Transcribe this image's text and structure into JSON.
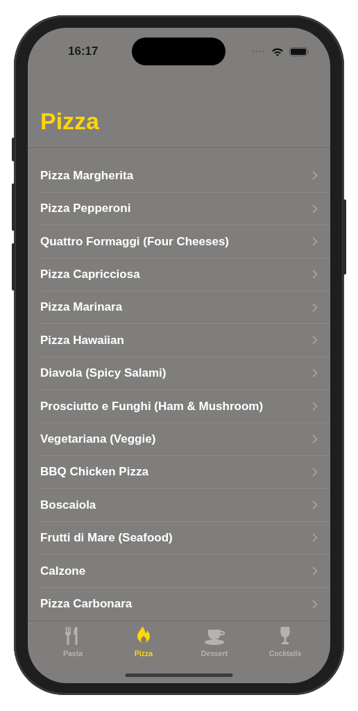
{
  "status_bar": {
    "time": "16:17"
  },
  "title": "Pizza",
  "items": [
    "Pizza Margherita",
    "Pizza Pepperoni",
    "Quattro Formaggi (Four Cheeses)",
    "Pizza Capricciosa",
    "Pizza Marinara",
    "Pizza Hawaiian",
    "Diavola (Spicy Salami)",
    "Prosciutto e Funghi (Ham & Mushroom)",
    "Vegetariana (Veggie)",
    "BBQ Chicken Pizza",
    "Boscaiola",
    "Frutti di Mare (Seafood)",
    "Calzone",
    "Pizza Carbonara"
  ],
  "tabs": [
    {
      "label": "Pasta",
      "kind": "fork-knife",
      "selected": false
    },
    {
      "label": "Pizza",
      "kind": "flame",
      "selected": true
    },
    {
      "label": "Dessert",
      "kind": "cup",
      "selected": false
    },
    {
      "label": "Cocktails",
      "kind": "glass",
      "selected": false
    }
  ]
}
